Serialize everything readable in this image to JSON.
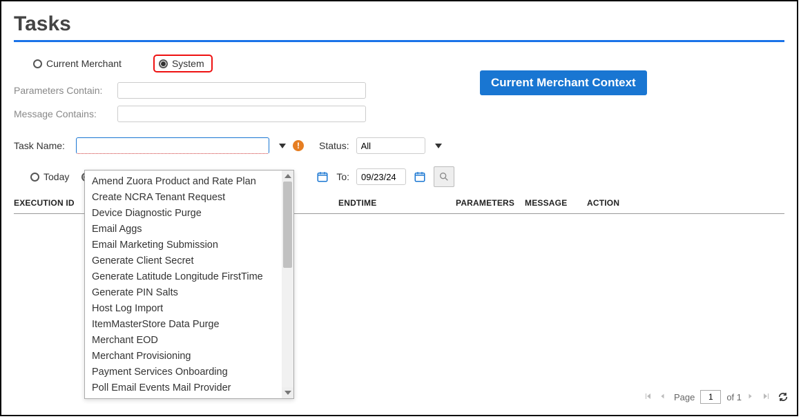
{
  "title": "Tasks",
  "scope": {
    "current_merchant_label": "Current Merchant",
    "system_label": "System",
    "selected": "system"
  },
  "context_button": "Current Merchant Context",
  "filters": {
    "parameters_label": "Parameters Contain:",
    "parameters_value": "",
    "message_label": "Message Contains:",
    "message_value": ""
  },
  "taskname": {
    "label": "Task Name:",
    "value": "",
    "options": [
      "Amend Zuora Product and Rate Plan",
      "Create NCRA Tenant Request",
      "Device Diagnostic Purge",
      "Email Aggs",
      "Email Marketing Submission",
      "Generate Client Secret",
      "Generate Latitude Longitude FirstTime",
      "Generate PIN Salts",
      "Host Log Import",
      "ItemMasterStore Data Purge",
      "Merchant EOD",
      "Merchant Provisioning",
      "Payment Services Onboarding",
      "Poll Email Events Mail Provider"
    ]
  },
  "status": {
    "label": "Status:",
    "value": "All"
  },
  "daterange": {
    "today_label": "Today",
    "to_label": "To:",
    "from_value": "",
    "to_value": "09/23/24"
  },
  "table": {
    "headers": {
      "execution_id": "EXECUTION ID",
      "endtime": "ENDTIME",
      "parameters": "PARAMETERS",
      "message": "MESSAGE",
      "action": "ACTION"
    }
  },
  "pager": {
    "page_label": "Page",
    "current": "1",
    "of_label": "of 1"
  }
}
